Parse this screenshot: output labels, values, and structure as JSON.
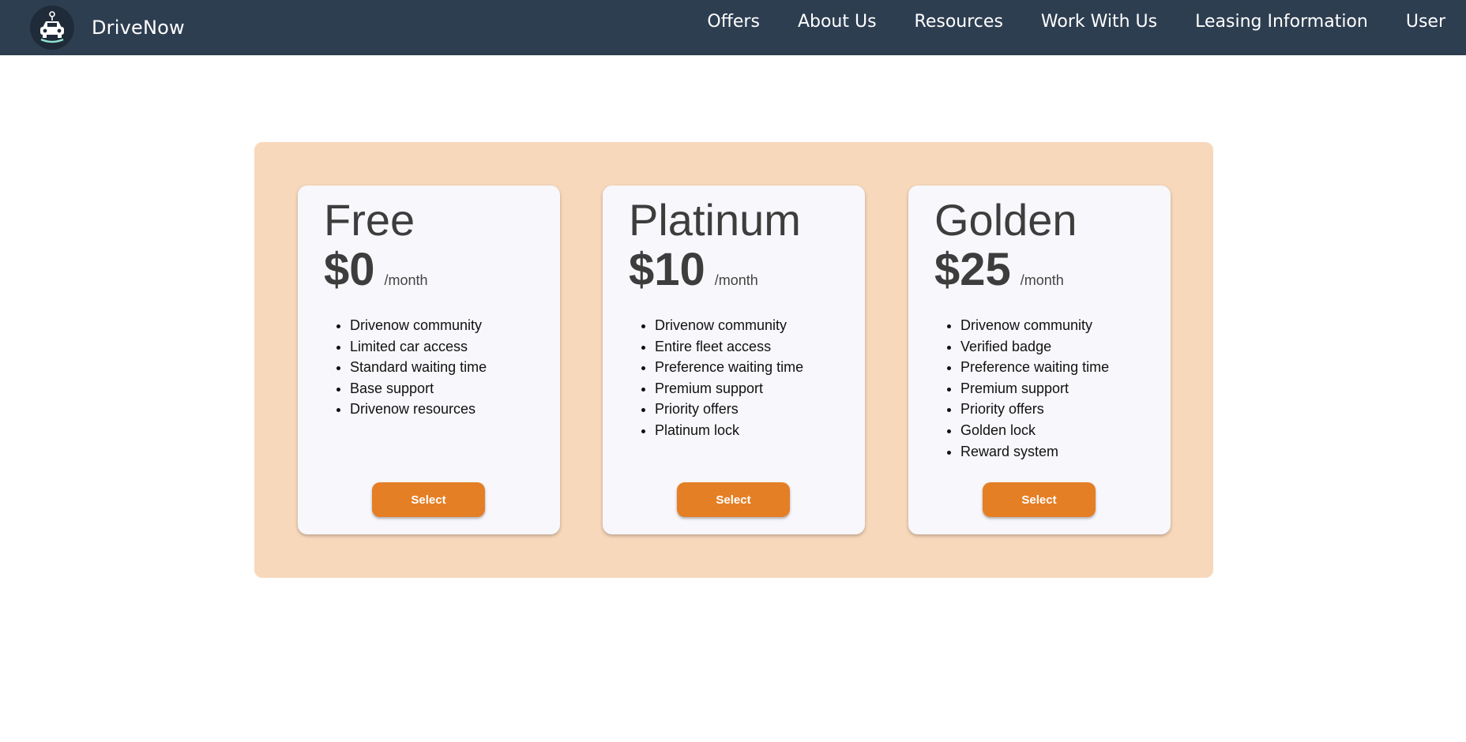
{
  "nav": {
    "brand": "DriveNow",
    "logo_icon": "car-logo-icon",
    "links": [
      "Offers",
      "About Us",
      "Resources",
      "Work With Us",
      "Leasing Information",
      "User"
    ]
  },
  "colors": {
    "navbar": "#2e3e51",
    "panel": "#f7d8bb",
    "card": "#f8f7fb",
    "button": "#e57f25"
  },
  "plans": [
    {
      "name": "Free",
      "price": "$0",
      "period": "/month",
      "features": [
        "Drivenow community",
        "Limited car access",
        "Standard waiting time",
        "Base support",
        "Drivenow resources"
      ],
      "button": "Select"
    },
    {
      "name": "Platinum",
      "price": "$10",
      "period": "/month",
      "features": [
        "Drivenow community",
        "Entire fleet access",
        "Preference waiting time",
        "Premium support",
        "Priority offers",
        "Platinum lock"
      ],
      "button": "Select"
    },
    {
      "name": "Golden",
      "price": "$25",
      "period": "/month",
      "features": [
        "Drivenow community",
        "Verified badge",
        "Preference waiting time",
        "Premium support",
        "Priority offers",
        "Golden lock",
        "Reward system"
      ],
      "button": "Select"
    }
  ]
}
